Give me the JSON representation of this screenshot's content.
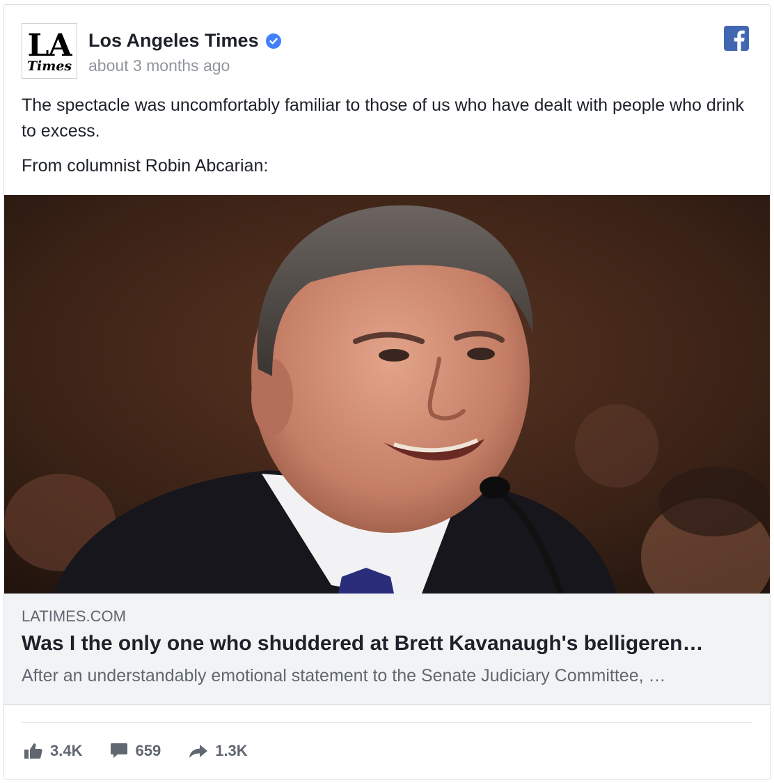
{
  "post": {
    "page_name": "Los Angeles Times",
    "timestamp": "about 3 months ago",
    "logo": {
      "line1": "LA",
      "line2": "Times"
    },
    "message": [
      "The spectacle was uncomfortably familiar to those of us who have dealt with people who drink to excess.",
      "From columnist Robin Abcarian:"
    ]
  },
  "link": {
    "domain": "LATIMES.COM",
    "headline": "Was I the only one who shuddered at Brett Kavanaugh's belligeren…",
    "description": "After an understandably emotional statement to the Senate Judiciary Committee, …"
  },
  "stats": {
    "likes": "3.4K",
    "comments": "659",
    "shares": "1.3K"
  },
  "icons": {
    "verified": "verified-badge-icon",
    "facebook": "facebook-icon",
    "like": "thumbs-up-icon",
    "comment": "comment-icon",
    "share": "share-arrow-icon"
  },
  "colors": {
    "verified_blue": "#4080ff",
    "facebook_blue": "#4267b2",
    "link_bg": "#f2f3f5",
    "muted_text": "#606770"
  }
}
